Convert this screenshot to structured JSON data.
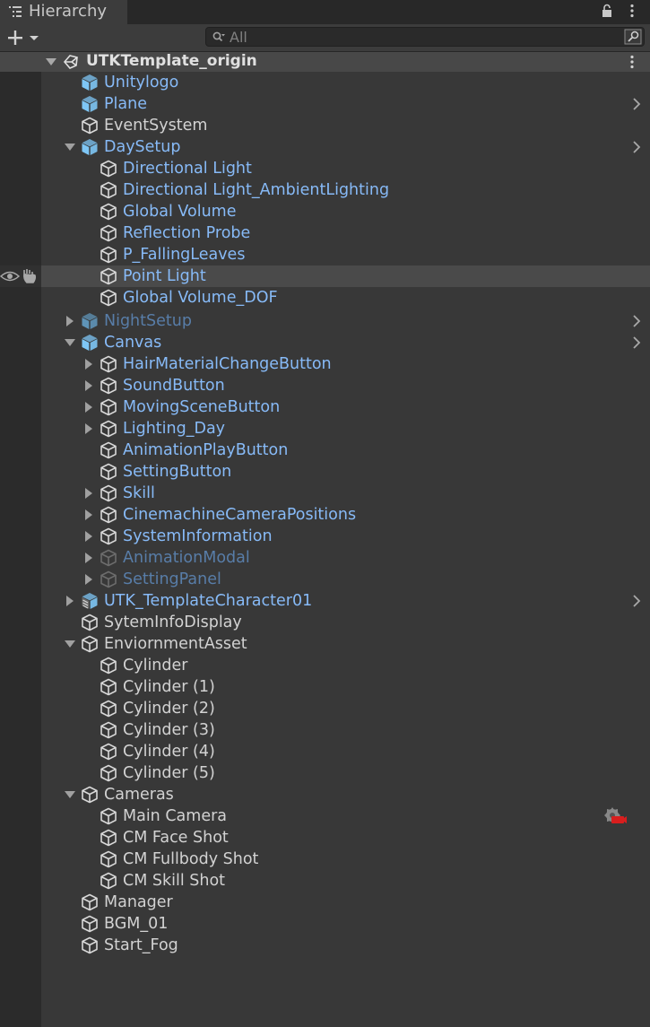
{
  "tab": {
    "title": "Hierarchy",
    "icon": "hierarchy-list-icon"
  },
  "toolbar": {
    "add_icon": "plus-icon",
    "search_placeholder": "All"
  },
  "scene": {
    "name": "UTKTemplate_origin",
    "icon": "unity-scene-icon"
  },
  "tree": [
    {
      "label": "Unitylogo",
      "depth": 0,
      "icon": "prefab",
      "color": "blue",
      "arrow": "none",
      "chevron": false
    },
    {
      "label": "Plane",
      "depth": 0,
      "icon": "prefab",
      "color": "blue",
      "arrow": "none",
      "chevron": true
    },
    {
      "label": "EventSystem",
      "depth": 0,
      "icon": "gameobject",
      "color": "white",
      "arrow": "none",
      "chevron": false
    },
    {
      "label": "DaySetup",
      "depth": 0,
      "icon": "prefab",
      "color": "blue",
      "arrow": "expanded",
      "chevron": true
    },
    {
      "label": "Directional Light",
      "depth": 1,
      "icon": "gameobject",
      "color": "blue",
      "arrow": "none",
      "chevron": false
    },
    {
      "label": "Directional Light_AmbientLighting",
      "depth": 1,
      "icon": "gameobject",
      "color": "blue",
      "arrow": "none",
      "chevron": false
    },
    {
      "label": "Global Volume",
      "depth": 1,
      "icon": "gameobject",
      "color": "blue",
      "arrow": "none",
      "chevron": false
    },
    {
      "label": "Reflection Probe",
      "depth": 1,
      "icon": "gameobject",
      "color": "blue",
      "arrow": "none",
      "chevron": false
    },
    {
      "label": "P_FallingLeaves",
      "depth": 1,
      "icon": "gameobject",
      "color": "blue",
      "arrow": "none",
      "chevron": false
    },
    {
      "label": "Point Light",
      "depth": 1,
      "icon": "gameobject",
      "color": "blue",
      "arrow": "none",
      "chevron": false,
      "selected": true
    },
    {
      "label": "Global Volume_DOF",
      "depth": 1,
      "icon": "gameobject",
      "color": "blue",
      "arrow": "none",
      "chevron": false
    },
    {
      "label": "NightSetup",
      "depth": 0,
      "icon": "prefab",
      "color": "dim",
      "arrow": "collapsed",
      "chevron": true
    },
    {
      "label": "Canvas",
      "depth": 0,
      "icon": "prefab",
      "color": "blue",
      "arrow": "expanded",
      "chevron": true
    },
    {
      "label": "HairMaterialChangeButton",
      "depth": 1,
      "icon": "gameobject",
      "color": "blue",
      "arrow": "collapsed",
      "chevron": false
    },
    {
      "label": "SoundButton",
      "depth": 1,
      "icon": "gameobject",
      "color": "blue",
      "arrow": "collapsed",
      "chevron": false
    },
    {
      "label": "MovingSceneButton",
      "depth": 1,
      "icon": "gameobject",
      "color": "blue",
      "arrow": "collapsed",
      "chevron": false
    },
    {
      "label": "Lighting_Day",
      "depth": 1,
      "icon": "gameobject",
      "color": "blue",
      "arrow": "collapsed",
      "chevron": false
    },
    {
      "label": "AnimationPlayButton",
      "depth": 1,
      "icon": "gameobject",
      "color": "blue",
      "arrow": "none",
      "chevron": false
    },
    {
      "label": "SettingButton",
      "depth": 1,
      "icon": "gameobject",
      "color": "blue",
      "arrow": "none",
      "chevron": false
    },
    {
      "label": "Skill",
      "depth": 1,
      "icon": "gameobject",
      "color": "blue",
      "arrow": "collapsed",
      "chevron": false
    },
    {
      "label": "CinemachineCameraPositions",
      "depth": 1,
      "icon": "gameobject",
      "color": "blue",
      "arrow": "collapsed",
      "chevron": false
    },
    {
      "label": "SystemInformation",
      "depth": 1,
      "icon": "gameobject",
      "color": "blue",
      "arrow": "collapsed",
      "chevron": false
    },
    {
      "label": "AnimationModal",
      "depth": 1,
      "icon": "gameobject",
      "color": "dim",
      "arrow": "collapsed",
      "chevron": false
    },
    {
      "label": "SettingPanel",
      "depth": 1,
      "icon": "gameobject",
      "color": "dim",
      "arrow": "collapsed",
      "chevron": false
    },
    {
      "label": "UTK_TemplateCharacter01",
      "depth": 0,
      "icon": "model-prefab",
      "color": "blue",
      "arrow": "collapsed",
      "chevron": true
    },
    {
      "label": "SytemInfoDisplay",
      "depth": 0,
      "icon": "gameobject",
      "color": "white",
      "arrow": "none",
      "chevron": false
    },
    {
      "label": "EnviornmentAsset",
      "depth": 0,
      "icon": "gameobject",
      "color": "white",
      "arrow": "expanded",
      "chevron": false
    },
    {
      "label": "Cylinder",
      "depth": 1,
      "icon": "gameobject",
      "color": "white",
      "arrow": "none",
      "chevron": false
    },
    {
      "label": "Cylinder (1)",
      "depth": 1,
      "icon": "gameobject",
      "color": "white",
      "arrow": "none",
      "chevron": false
    },
    {
      "label": "Cylinder (2)",
      "depth": 1,
      "icon": "gameobject",
      "color": "white",
      "arrow": "none",
      "chevron": false
    },
    {
      "label": "Cylinder (3)",
      "depth": 1,
      "icon": "gameobject",
      "color": "white",
      "arrow": "none",
      "chevron": false
    },
    {
      "label": "Cylinder (4)",
      "depth": 1,
      "icon": "gameobject",
      "color": "white",
      "arrow": "none",
      "chevron": false
    },
    {
      "label": "Cylinder (5)",
      "depth": 1,
      "icon": "gameobject",
      "color": "white",
      "arrow": "none",
      "chevron": false
    },
    {
      "label": "Cameras",
      "depth": 0,
      "icon": "gameobject",
      "color": "white",
      "arrow": "expanded",
      "chevron": false
    },
    {
      "label": "Main Camera",
      "depth": 1,
      "icon": "gameobject",
      "color": "white",
      "arrow": "none",
      "chevron": false,
      "gizmo": "camera-warning-icon"
    },
    {
      "label": "CM Face Shot",
      "depth": 1,
      "icon": "gameobject",
      "color": "white",
      "arrow": "none",
      "chevron": false
    },
    {
      "label": "CM Fullbody Shot",
      "depth": 1,
      "icon": "gameobject",
      "color": "white",
      "arrow": "none",
      "chevron": false
    },
    {
      "label": "CM Skill Shot",
      "depth": 1,
      "icon": "gameobject",
      "color": "white",
      "arrow": "none",
      "chevron": false
    },
    {
      "label": "Manager",
      "depth": 0,
      "icon": "gameobject",
      "color": "white",
      "arrow": "none",
      "chevron": false
    },
    {
      "label": "BGM_01",
      "depth": 0,
      "icon": "gameobject",
      "color": "white",
      "arrow": "none",
      "chevron": false
    },
    {
      "label": "Start_Fog",
      "depth": 0,
      "icon": "gameobject",
      "color": "white",
      "arrow": "none",
      "chevron": false
    }
  ],
  "colors": {
    "blue": "#87baf7",
    "dim": "#587da8",
    "white": "#d2d2d2",
    "prefab": "#7ec6f5"
  }
}
